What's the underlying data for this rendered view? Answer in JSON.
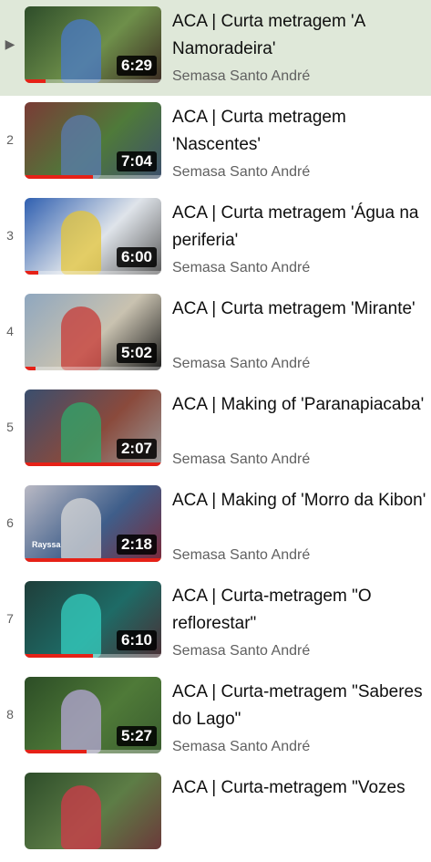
{
  "playlist": {
    "items": [
      {
        "index": "▶",
        "title": "ACA | Curta metragem 'A Namoradeira'",
        "channel": "Semasa Santo André",
        "duration": "6:29",
        "progress": 0.15,
        "active": true,
        "thumb_colors": [
          "#2e4d2a",
          "#6e8f4a",
          "#3b2a22"
        ],
        "accent": "#4a79c8"
      },
      {
        "index": "2",
        "title": "ACA | Curta metragem 'Nascentes'",
        "channel": "Semasa Santo André",
        "duration": "7:04",
        "progress": 0.5,
        "active": false,
        "thumb_colors": [
          "#7a3b36",
          "#4f7a3a",
          "#3d4f6b"
        ],
        "accent": "#5a7bb0"
      },
      {
        "index": "3",
        "title": "ACA | Curta metragem 'Água na periferia'",
        "channel": "Semasa Santo André",
        "duration": "6:00",
        "progress": 0.1,
        "active": false,
        "thumb_colors": [
          "#2f5fb0",
          "#dfe4ea",
          "#5a5a5a"
        ],
        "accent": "#e4c63a"
      },
      {
        "index": "4",
        "title": "ACA | Curta metragem 'Mirante'",
        "channel": "Semasa Santo André",
        "duration": "5:02",
        "progress": 0.08,
        "active": false,
        "thumb_colors": [
          "#8fa7bf",
          "#c9c2b0",
          "#1d1d1d"
        ],
        "accent": "#c83a36"
      },
      {
        "index": "5",
        "title": "ACA | Making of 'Paranapiacaba'",
        "channel": "Semasa Santo André",
        "duration": "2:07",
        "progress": 1.0,
        "active": false,
        "thumb_colors": [
          "#3a4e6e",
          "#8a4a3c",
          "#9a9a9a"
        ],
        "accent": "#2fa86a"
      },
      {
        "index": "6",
        "title": "ACA | Making of 'Morro da Kibon'",
        "channel": "Semasa Santo André",
        "duration": "2:18",
        "progress": 1.0,
        "active": false,
        "thumb_colors": [
          "#b9b9c4",
          "#3f5e8a",
          "#7a2a3a"
        ],
        "accent": "#d8d8d8",
        "tag": "Rayssa"
      },
      {
        "index": "7",
        "title": "ACA | Curta-metragem \"O reflorestar\"",
        "channel": "Semasa Santo André",
        "duration": "6:10",
        "progress": 0.5,
        "active": false,
        "thumb_colors": [
          "#1f3e3a",
          "#1e6b66",
          "#4a2f35"
        ],
        "accent": "#36d0c2"
      },
      {
        "index": "8",
        "title": "ACA | Curta-metragem \"Saberes do Lago\"",
        "channel": "Semasa Santo André",
        "duration": "5:27",
        "progress": 0.45,
        "active": false,
        "thumb_colors": [
          "#2c4d26",
          "#4f7a38",
          "#3a5c2f"
        ],
        "accent": "#b7a8d8"
      },
      {
        "index": "",
        "title": "ACA | Curta-metragem \"Vozes",
        "channel": "",
        "duration": "",
        "progress": 0,
        "active": false,
        "thumb_colors": [
          "#2e4d2a",
          "#5d7d46",
          "#6b3a3a"
        ],
        "accent": "#d03a4a"
      }
    ]
  }
}
